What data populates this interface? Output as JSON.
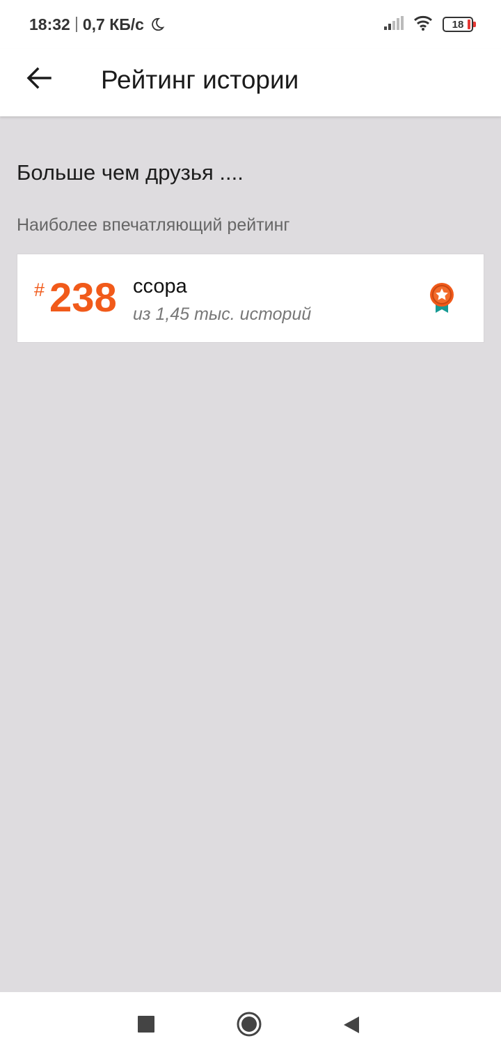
{
  "status_bar": {
    "time": "18:32",
    "network_speed": "0,7 КБ/с",
    "battery_level": "18"
  },
  "app_bar": {
    "title": "Рейтинг истории",
    "back_icon": "arrow-back-icon"
  },
  "content": {
    "heading": "Больше чем друзья ....",
    "subheading": "Наиболее впечатляющий рейтинг"
  },
  "rank_card": {
    "hash": "#",
    "rank": "238",
    "tag": "ссора",
    "total": "из 1,45 тыс. историй",
    "icon": "award-medal-icon",
    "accent_color": "#f15a1a"
  },
  "nav_bar": {
    "recents_icon": "square-icon",
    "home_icon": "circle-icon",
    "back_icon": "triangle-back-icon"
  }
}
